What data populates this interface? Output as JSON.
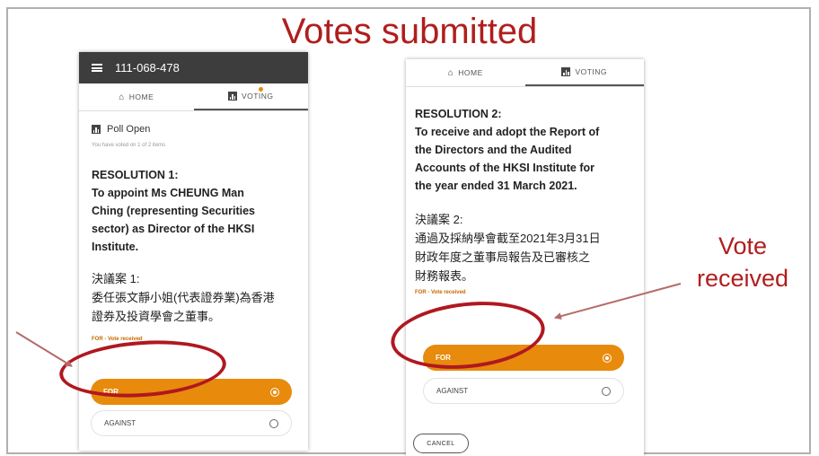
{
  "slide": {
    "title": "Votes submitted",
    "callout_right": [
      "Vote",
      "received"
    ]
  },
  "phone1": {
    "meeting_id": "111-068-478",
    "tab_home": "HOME",
    "tab_voting": "VOTING",
    "poll_status": "Poll Open",
    "voted_note": "You have voted on 1 of 2 items",
    "resolution_title": "RESOLUTION 1:",
    "resolution_lines": [
      "To appoint Ms CHEUNG Man",
      "Ching (representing Securities",
      "sector) as Director of the HKSI",
      "Institute."
    ],
    "zh_title": "決議案 1:",
    "zh_lines": [
      "委任張文靜小姐(代表證券業)為香港",
      "證券及投資學會之董事。"
    ],
    "vote_status": "FOR - Vote received",
    "option_for": "FOR",
    "option_against": "AGAINST"
  },
  "phone2": {
    "tab_home": "HOME",
    "tab_voting": "VOTING",
    "resolution_title": "RESOLUTION 2:",
    "resolution_lines": [
      "To receive and adopt the Report of",
      "the Directors and the Audited",
      "Accounts of the HKSI Institute for",
      "the year ended 31 March 2021."
    ],
    "zh_title": "決議案 2:",
    "zh_lines": [
      "通過及採納學會截至2021年3月31日",
      "財政年度之董事局報告及已審核之",
      "財務報表。"
    ],
    "vote_status": "FOR - Vote received",
    "option_for": "FOR",
    "option_against": "AGAINST",
    "cancel_label": "CANCEL"
  },
  "colors": {
    "accent": "#e88a0c",
    "annotation_red": "#b01e1e",
    "appbar": "#3d3d3d"
  }
}
